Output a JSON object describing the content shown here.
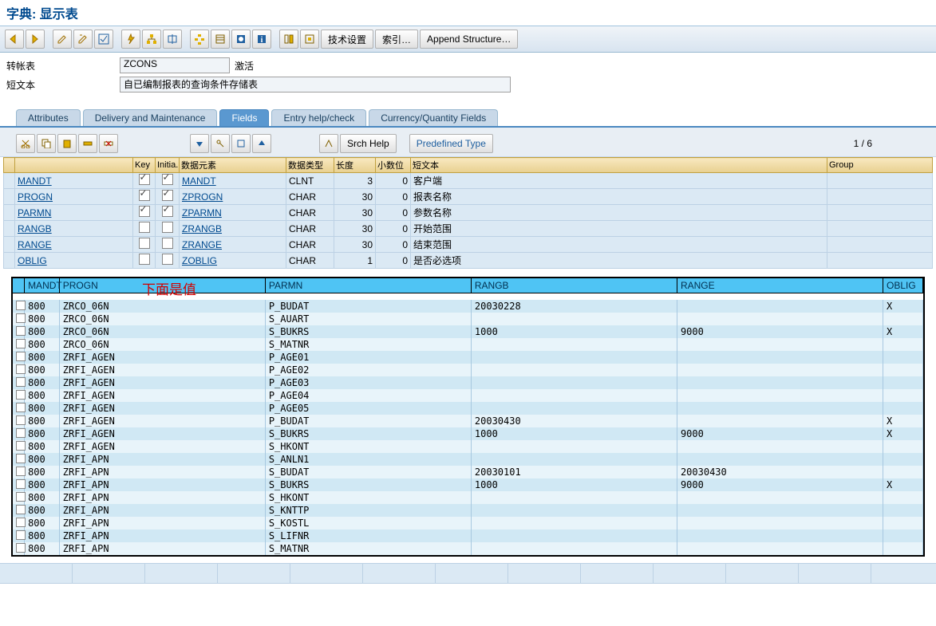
{
  "title_prefix": "字典:",
  "title_main": "显示表",
  "toolbar": {
    "tech_settings": "技术设置",
    "index": "索引…",
    "append": "Append Structure…"
  },
  "header": {
    "table_label": "转帐表",
    "table_name": "ZCONS",
    "status": "激活",
    "short_label": "短文本",
    "short_text": "自已编制报表的查询条件存储表"
  },
  "tabs": {
    "attributes": "Attributes",
    "delivery": "Delivery and Maintenance",
    "fields": "Fields",
    "entry": "Entry help/check",
    "currency": "Currency/Quantity Fields"
  },
  "subtoolbar": {
    "srch": "Srch Help",
    "predef": "Predefined Type",
    "page": "1 / 6"
  },
  "def_cols": {
    "blank": "",
    "key": "Key",
    "init": "Initia..",
    "dataelem": "数据元素",
    "datatype": "数据类型",
    "length": "长度",
    "dec": "小数位",
    "short": "短文本",
    "group": "Group"
  },
  "def_rows": [
    {
      "name": "MANDT",
      "key": true,
      "init": true,
      "elem": "MANDT",
      "type": "CLNT",
      "len": "3",
      "dec": "0",
      "txt": "客户端"
    },
    {
      "name": "PROGN",
      "key": true,
      "init": true,
      "elem": "ZPROGN",
      "type": "CHAR",
      "len": "30",
      "dec": "0",
      "txt": "报表名称"
    },
    {
      "name": "PARMN",
      "key": true,
      "init": true,
      "elem": "ZPARMN",
      "type": "CHAR",
      "len": "30",
      "dec": "0",
      "txt": "参数名称"
    },
    {
      "name": "RANGB",
      "key": false,
      "init": false,
      "elem": "ZRANGB",
      "type": "CHAR",
      "len": "30",
      "dec": "0",
      "txt": "开始范围"
    },
    {
      "name": "RANGE",
      "key": false,
      "init": false,
      "elem": "ZRANGE",
      "type": "CHAR",
      "len": "30",
      "dec": "0",
      "txt": "结束范围"
    },
    {
      "name": "OBLIG",
      "key": false,
      "init": false,
      "elem": "ZOBLIG",
      "type": "CHAR",
      "len": "1",
      "dec": "0",
      "txt": "是否必选项"
    }
  ],
  "annotation": "下面是值",
  "data_cols": {
    "mandt": "MANDT",
    "progn": "PROGN",
    "parmn": "PARMN",
    "rangb": "RANGB",
    "range": "RANGE",
    "oblig": "OBLIG"
  },
  "data_rows": [
    {
      "m": "800",
      "pg": "ZRCO_06N",
      "pm": "P_BUDAT",
      "rb": "20030228",
      "re": "",
      "ob": "X"
    },
    {
      "m": "800",
      "pg": "ZRCO_06N",
      "pm": "S_AUART",
      "rb": "",
      "re": "",
      "ob": ""
    },
    {
      "m": "800",
      "pg": "ZRCO_06N",
      "pm": "S_BUKRS",
      "rb": "1000",
      "re": "9000",
      "ob": "X"
    },
    {
      "m": "800",
      "pg": "ZRCO_06N",
      "pm": "S_MATNR",
      "rb": "",
      "re": "",
      "ob": ""
    },
    {
      "m": "800",
      "pg": "ZRFI_AGEN",
      "pm": "P_AGE01",
      "rb": "",
      "re": "",
      "ob": ""
    },
    {
      "m": "800",
      "pg": "ZRFI_AGEN",
      "pm": "P_AGE02",
      "rb": "",
      "re": "",
      "ob": ""
    },
    {
      "m": "800",
      "pg": "ZRFI_AGEN",
      "pm": "P_AGE03",
      "rb": "",
      "re": "",
      "ob": ""
    },
    {
      "m": "800",
      "pg": "ZRFI_AGEN",
      "pm": "P_AGE04",
      "rb": "",
      "re": "",
      "ob": ""
    },
    {
      "m": "800",
      "pg": "ZRFI_AGEN",
      "pm": "P_AGE05",
      "rb": "",
      "re": "",
      "ob": ""
    },
    {
      "m": "800",
      "pg": "ZRFI_AGEN",
      "pm": "P_BUDAT",
      "rb": "20030430",
      "re": "",
      "ob": "X"
    },
    {
      "m": "800",
      "pg": "ZRFI_AGEN",
      "pm": "S_BUKRS",
      "rb": "1000",
      "re": "9000",
      "ob": "X"
    },
    {
      "m": "800",
      "pg": "ZRFI_AGEN",
      "pm": "S_HKONT",
      "rb": "",
      "re": "",
      "ob": ""
    },
    {
      "m": "800",
      "pg": "ZRFI_APN",
      "pm": "S_ANLN1",
      "rb": "",
      "re": "",
      "ob": ""
    },
    {
      "m": "800",
      "pg": "ZRFI_APN",
      "pm": "S_BUDAT",
      "rb": "20030101",
      "re": "20030430",
      "ob": ""
    },
    {
      "m": "800",
      "pg": "ZRFI_APN",
      "pm": "S_BUKRS",
      "rb": "1000",
      "re": "9000",
      "ob": "X"
    },
    {
      "m": "800",
      "pg": "ZRFI_APN",
      "pm": "S_HKONT",
      "rb": "",
      "re": "",
      "ob": ""
    },
    {
      "m": "800",
      "pg": "ZRFI_APN",
      "pm": "S_KNTTP",
      "rb": "",
      "re": "",
      "ob": ""
    },
    {
      "m": "800",
      "pg": "ZRFI_APN",
      "pm": "S_KOSTL",
      "rb": "",
      "re": "",
      "ob": ""
    },
    {
      "m": "800",
      "pg": "ZRFI_APN",
      "pm": "S_LIFNR",
      "rb": "",
      "re": "",
      "ob": ""
    },
    {
      "m": "800",
      "pg": "ZRFI_APN",
      "pm": "S_MATNR",
      "rb": "",
      "re": "",
      "ob": ""
    }
  ]
}
